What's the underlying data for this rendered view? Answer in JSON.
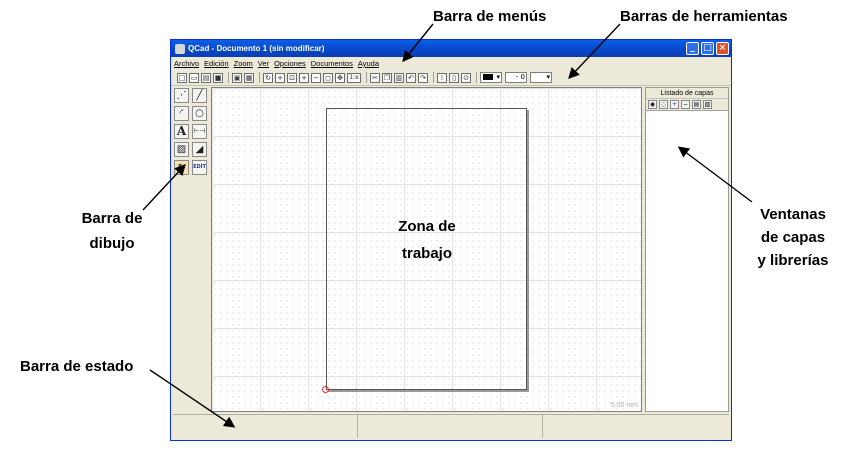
{
  "callouts": {
    "menu_bar": "Barra de menús",
    "toolbars": "Barras de herramientas",
    "draw_bar_1": "Barra de",
    "draw_bar_2": "dibujo",
    "work_zone_1": "Zona de",
    "work_zone_2": "trabajo",
    "layers_1": "Ventanas",
    "layers_2": "de capas",
    "layers_3": "y librerías",
    "status_bar": "Barra de estado"
  },
  "window": {
    "title": "QCad - Documento 1 (sin modificar)",
    "controls": {
      "minimize": "_",
      "maximize": "□",
      "close": "×"
    }
  },
  "menu": [
    "Archivo",
    "Edición",
    "Zoom",
    "Ver",
    "Opciones",
    "Documentos",
    "Ayuda"
  ],
  "toolbar": {
    "zoom_one": "1:x",
    "width_select": "- 0",
    "color_select_arrow": "▾"
  },
  "drawbar": {
    "edit_label": "EDIT",
    "text_label": "A"
  },
  "workarea": {
    "scale_label": "5.00 mm"
  },
  "layers": {
    "header": "Listado de capas"
  },
  "colors": {
    "title_blue": "#0846c8",
    "window_bg": "#ece9d8",
    "origin_red": "#e03030"
  }
}
